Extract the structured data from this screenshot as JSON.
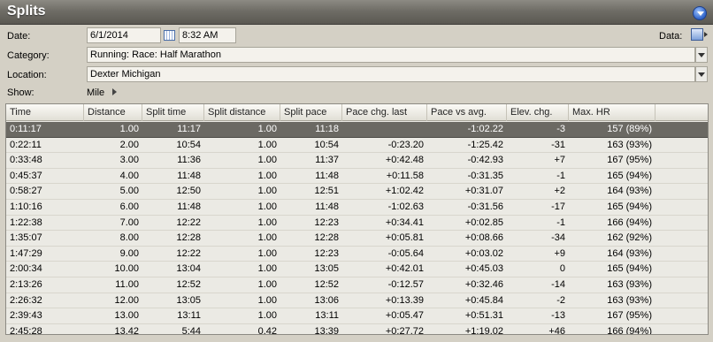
{
  "panel": {
    "title": "Splits"
  },
  "form": {
    "date_label": "Date:",
    "date_value": "6/1/2014",
    "time_value": "8:32 AM",
    "data_label": "Data:",
    "category_label": "Category:",
    "category_value": "Running: Race: Half Marathon",
    "location_label": "Location:",
    "location_value": "Dexter Michigan",
    "show_label": "Show:",
    "show_value": "Mile"
  },
  "table": {
    "columns": [
      "Time",
      "Distance",
      "Split time",
      "Split distance",
      "Split pace",
      "Pace chg. last",
      "Pace vs avg.",
      "Elev. chg.",
      "Max. HR"
    ],
    "rows": [
      [
        "0:11:17",
        "1.00",
        "11:17",
        "1.00",
        "11:18",
        "",
        "-1:02.22",
        "-3",
        "157 (89%)"
      ],
      [
        "0:22:11",
        "2.00",
        "10:54",
        "1.00",
        "10:54",
        "-0:23.20",
        "-1:25.42",
        "-31",
        "163 (93%)"
      ],
      [
        "0:33:48",
        "3.00",
        "11:36",
        "1.00",
        "11:37",
        "+0:42.48",
        "-0:42.93",
        "+7",
        "167 (95%)"
      ],
      [
        "0:45:37",
        "4.00",
        "11:48",
        "1.00",
        "11:48",
        "+0:11.58",
        "-0:31.35",
        "-1",
        "165 (94%)"
      ],
      [
        "0:58:27",
        "5.00",
        "12:50",
        "1.00",
        "12:51",
        "+1:02.42",
        "+0:31.07",
        "+2",
        "164 (93%)"
      ],
      [
        "1:10:16",
        "6.00",
        "11:48",
        "1.00",
        "11:48",
        "-1:02.63",
        "-0:31.56",
        "-17",
        "165 (94%)"
      ],
      [
        "1:22:38",
        "7.00",
        "12:22",
        "1.00",
        "12:23",
        "+0:34.41",
        "+0:02.85",
        "-1",
        "166 (94%)"
      ],
      [
        "1:35:07",
        "8.00",
        "12:28",
        "1.00",
        "12:28",
        "+0:05.81",
        "+0:08.66",
        "-34",
        "162 (92%)"
      ],
      [
        "1:47:29",
        "9.00",
        "12:22",
        "1.00",
        "12:23",
        "-0:05.64",
        "+0:03.02",
        "+9",
        "164 (93%)"
      ],
      [
        "2:00:34",
        "10.00",
        "13:04",
        "1.00",
        "13:05",
        "+0:42.01",
        "+0:45.03",
        "0",
        "165 (94%)"
      ],
      [
        "2:13:26",
        "11.00",
        "12:52",
        "1.00",
        "12:52",
        "-0:12.57",
        "+0:32.46",
        "-14",
        "163 (93%)"
      ],
      [
        "2:26:32",
        "12.00",
        "13:05",
        "1.00",
        "13:06",
        "+0:13.39",
        "+0:45.84",
        "-2",
        "163 (93%)"
      ],
      [
        "2:39:43",
        "13.00",
        "13:11",
        "1.00",
        "13:11",
        "+0:05.47",
        "+0:51.31",
        "-13",
        "167 (95%)"
      ],
      [
        "2:45:28",
        "13.42",
        "5:44",
        "0.42",
        "13:39",
        "+0:27.72",
        "+1:19.02",
        "+46",
        "166 (94%)"
      ]
    ],
    "selected_row": 0
  },
  "colors": {
    "panel_bg": "#d4d0c5",
    "title_bar": "#6f6d66",
    "selected_row": "#6b6963",
    "grid_bg": "#ebeae4"
  }
}
